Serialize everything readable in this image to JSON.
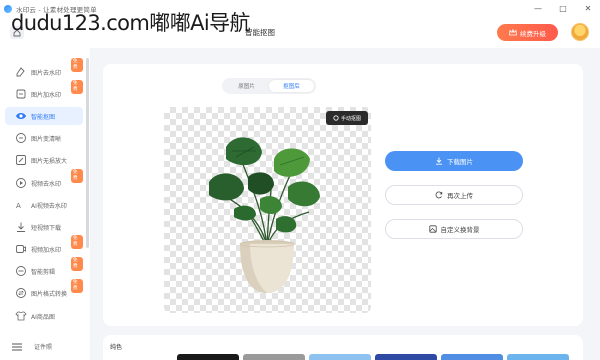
{
  "app": {
    "title": "水印云 - 让素材处理更简单"
  },
  "watermark": {
    "text": "dudu123.com嘟嘟Ai导航"
  },
  "header": {
    "page_title": "智能抠图",
    "vip_label": "续费升级"
  },
  "sidebar": {
    "items": [
      {
        "label": "图片去水印",
        "icon": "eraser-icon",
        "badge": "免费"
      },
      {
        "label": "图片加水印",
        "icon": "stamp-icon",
        "badge": "免费"
      },
      {
        "label": "智能抠图",
        "icon": "cutout-icon",
        "badge": ""
      },
      {
        "label": "图片变清晰",
        "icon": "enhance-icon",
        "badge": ""
      },
      {
        "label": "图片无损放大",
        "icon": "enlarge-icon",
        "badge": ""
      },
      {
        "label": "视频去水印",
        "icon": "video-icon",
        "badge": "免费"
      },
      {
        "label": "AI视频去水印",
        "icon": "ai-video-icon",
        "badge": ""
      },
      {
        "label": "短视频下载",
        "icon": "download-icon",
        "badge": ""
      },
      {
        "label": "视频加水印",
        "icon": "video-stamp-icon",
        "badge": "免费"
      },
      {
        "label": "智能剪辑",
        "icon": "clip-icon",
        "badge": "免费"
      },
      {
        "label": "图片格式转换",
        "icon": "convert-icon",
        "badge": "免费"
      },
      {
        "label": "AI商品图",
        "icon": "shirt-icon",
        "badge": ""
      }
    ],
    "bottom_label": "证件照"
  },
  "main": {
    "tabs": [
      {
        "label": "原图片"
      },
      {
        "label": "抠图后"
      }
    ],
    "manual_cutout_label": "手动抠图",
    "download_label": "下载图片",
    "reupload_label": "再次上传",
    "custom_bg_label": "自定义换背景"
  },
  "bottom": {
    "section_label": "纯色",
    "swatches": [
      "#1a1a1a",
      "#9a9a9a",
      "#8ec2f0",
      "#2e4aa5",
      "#4f8ee2",
      "#6bb4ee"
    ]
  },
  "colors": {
    "accent": "#2f7cf6",
    "vip": "#ff6a4c"
  }
}
